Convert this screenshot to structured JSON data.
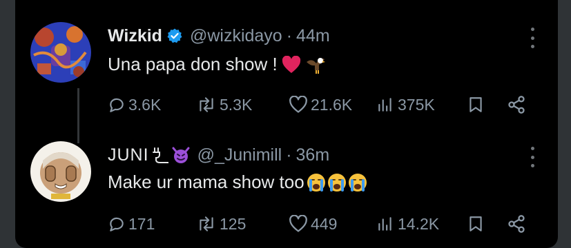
{
  "tweets": [
    {
      "name": "Wizkid",
      "handle": "@wizkidayo",
      "separator": "·",
      "time": "44m",
      "text": "Una papa don show !",
      "emoji": [
        "red-heart",
        "eagle"
      ],
      "verified": true,
      "stats": {
        "replies": "3.6K",
        "reposts": "5.3K",
        "likes": "21.6K",
        "views": "375K"
      }
    },
    {
      "name": "JUNI",
      "handle": "@_Junimill",
      "separator": "·",
      "time": "36m",
      "text": "Make ur mama show too",
      "emoji": [
        "loudly-crying-face",
        "loudly-crying-face",
        "loudly-crying-face"
      ],
      "name_icons": [
        "plug-icon",
        "smiling-devil-emoji"
      ],
      "stats": {
        "replies": "171",
        "reposts": "125",
        "likes": "449",
        "views": "14.2K"
      }
    }
  ],
  "colors": {
    "background": "#000000",
    "text": "#e7e9ea",
    "muted": "#8b98a5",
    "verified": "#1d9bf0",
    "heart": "#f91880"
  }
}
